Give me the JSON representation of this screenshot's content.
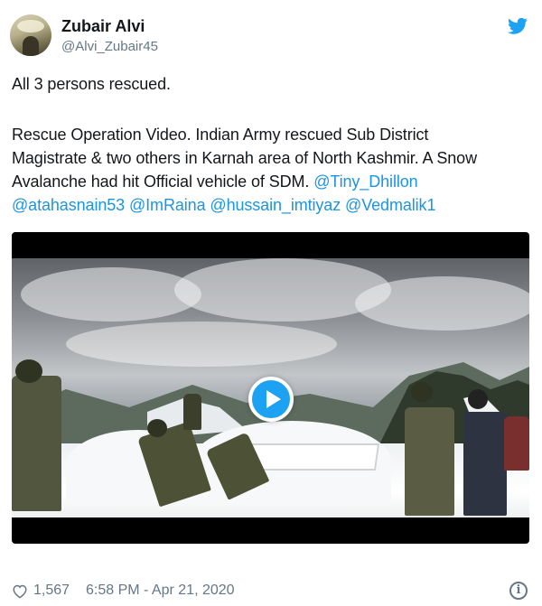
{
  "author": {
    "name": "Zubair Alvi",
    "handle": "@Alvi_Zubair45"
  },
  "tweet": {
    "line1": "All 3 persons rescued.",
    "line2": "Rescue Operation Video. Indian Army rescued Sub District",
    "line3": "Magistrate & two others in Karnah area of North Kashmir. A Snow",
    "line4_text": "Avalanche had hit Official vehicle of SDM. ",
    "mentions": [
      "@Tiny_Dhillon",
      "@atahasnain53",
      "@ImRaina",
      "@hussain_imtiyaz",
      "@Vedmalik1"
    ]
  },
  "media": {
    "type": "video"
  },
  "footer": {
    "likes": "1,567",
    "timestamp": "6:58 PM - Apr 21, 2020"
  },
  "icons": {
    "brand": "twitter-bird-icon",
    "play": "play-icon",
    "like": "heart-icon",
    "info": "info-icon"
  },
  "colors": {
    "accent": "#1da1f2",
    "link": "#1b95e0",
    "text": "#14171a",
    "muted": "#657786"
  }
}
